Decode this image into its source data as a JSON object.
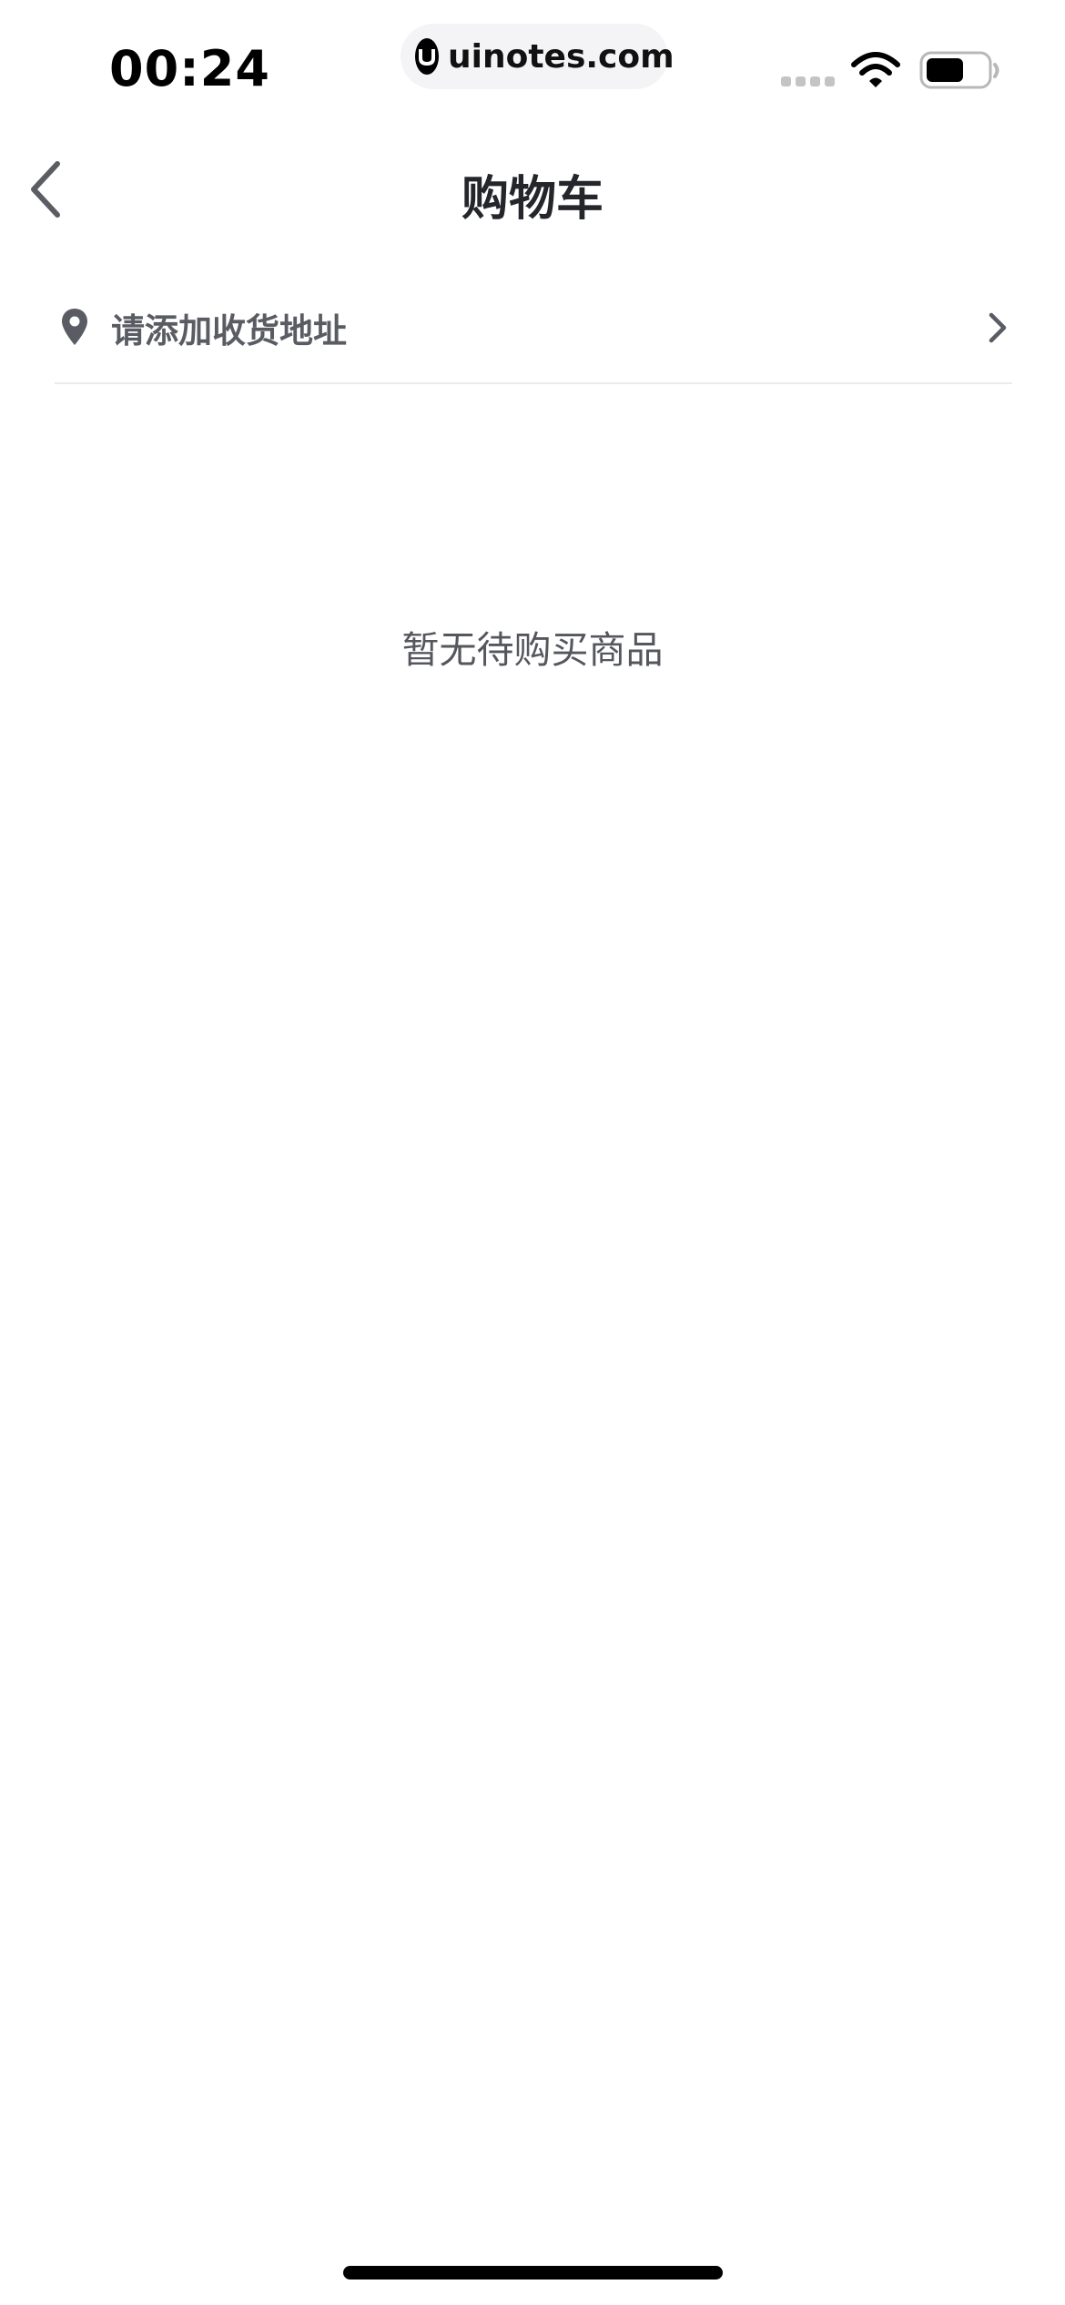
{
  "status_bar": {
    "time": "00:24",
    "url": "uinotes.com",
    "icons": [
      "signal-icon",
      "wifi-icon",
      "battery-icon"
    ]
  },
  "header": {
    "title": "购物车",
    "back_icon": "chevron-left-icon"
  },
  "address": {
    "label": "请添加收货地址",
    "icon": "location-pin-icon",
    "chevron_icon": "chevron-right-icon"
  },
  "cart": {
    "empty_message": "暂无待购买商品"
  },
  "colors": {
    "background": "#ffffff",
    "title_text": "#24262b",
    "secondary_text": "#5a5c64",
    "divider": "#ebebed"
  }
}
